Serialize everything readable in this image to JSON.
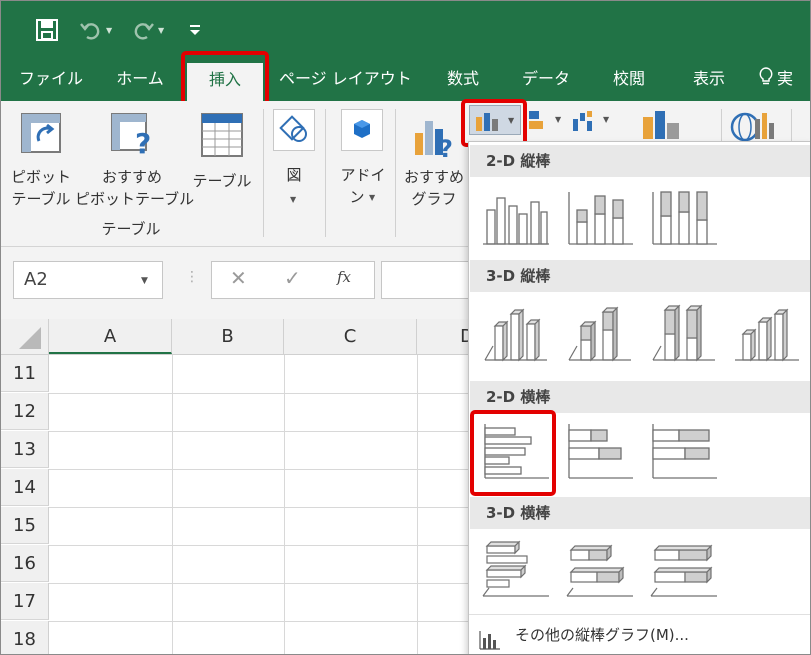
{
  "colors": {
    "excel_green": "#217346",
    "highlight_red": "#e30000"
  },
  "quick_access": {
    "save_icon": "save-icon",
    "undo_icon": "undo-icon",
    "redo_icon": "redo-icon",
    "customize_icon": "customize-qat-icon"
  },
  "tabs": [
    {
      "label": "ファイル"
    },
    {
      "label": "ホーム"
    },
    {
      "label": "挿入",
      "active": true
    },
    {
      "label": "ページ レイアウト"
    },
    {
      "label": "数式"
    },
    {
      "label": "データ"
    },
    {
      "label": "校閲"
    },
    {
      "label": "表示"
    },
    {
      "label": "実"
    }
  ],
  "ribbon": {
    "pivot_table": {
      "line1": "ピボット",
      "line2": "テーブル"
    },
    "recommended_pivot": {
      "line1": "おすすめ",
      "line2": "ピボットテーブル"
    },
    "table": {
      "label": "テーブル"
    },
    "group_label": "テーブル",
    "illustrations": {
      "label": "図"
    },
    "addins": {
      "line1": "アドイ",
      "line2": "ン"
    },
    "recommended_charts": {
      "line1": "おすすめ",
      "line2": "グラフ"
    }
  },
  "formula_bar": {
    "name_box": "A2",
    "cancel": "✕",
    "enter": "✓",
    "fx": "fx"
  },
  "columns": [
    "A",
    "B",
    "C",
    "D"
  ],
  "rows": [
    "11",
    "12",
    "13",
    "14",
    "15",
    "16",
    "17",
    "18"
  ],
  "gallery": {
    "sections": [
      {
        "title": "2-D 縦棒",
        "items": [
          "clustered-column",
          "stacked-column",
          "100-stacked-column"
        ]
      },
      {
        "title": "3-D 縦棒",
        "items": [
          "3d-clustered-column",
          "3d-stacked-column",
          "3d-100-stacked-column",
          "3d-column"
        ]
      },
      {
        "title": "2-D 横棒",
        "items": [
          "clustered-bar",
          "stacked-bar",
          "100-stacked-bar"
        ]
      },
      {
        "title": "3-D 横棒",
        "items": [
          "3d-clustered-bar",
          "3d-stacked-bar",
          "3d-100-stacked-bar"
        ]
      }
    ],
    "more": "その他の縦棒グラフ(M)..."
  }
}
